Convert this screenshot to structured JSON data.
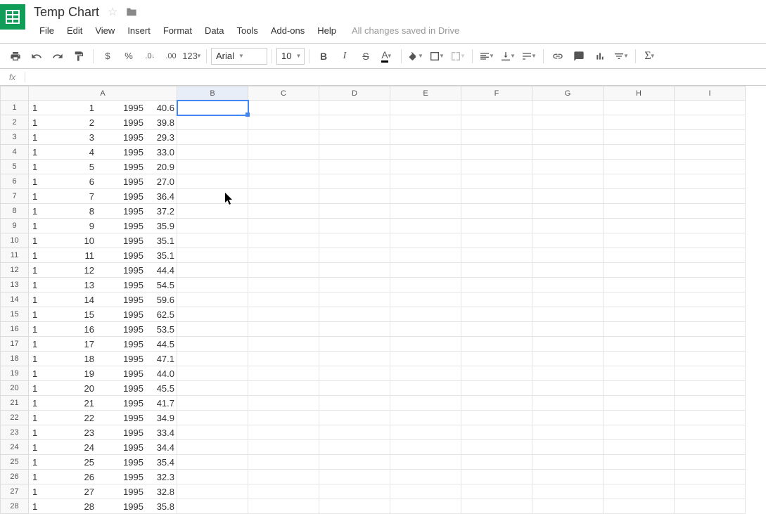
{
  "doc": {
    "title": "Temp Chart",
    "save_status": "All changes saved in Drive"
  },
  "menu": {
    "file": "File",
    "edit": "Edit",
    "view": "View",
    "insert": "Insert",
    "format": "Format",
    "data": "Data",
    "tools": "Tools",
    "addons": "Add-ons",
    "help": "Help"
  },
  "toolbar": {
    "currency": "$",
    "percent": "%",
    "dec_dec": ".0",
    "inc_dec": ".00",
    "num_format": "123",
    "font": "Arial",
    "font_size": "10",
    "bold": "B",
    "italic": "I",
    "strike": "S",
    "text_color": "A"
  },
  "formula_bar": {
    "fx": "fx",
    "value": ""
  },
  "columns": [
    "A",
    "B",
    "C",
    "D",
    "E",
    "F",
    "G",
    "H",
    "I"
  ],
  "rows": [
    {
      "n": 1,
      "c1": "1",
      "c2": "1",
      "c3": "1995",
      "c4": "40.6"
    },
    {
      "n": 2,
      "c1": "1",
      "c2": "2",
      "c3": "1995",
      "c4": "39.8"
    },
    {
      "n": 3,
      "c1": "1",
      "c2": "3",
      "c3": "1995",
      "c4": "29.3"
    },
    {
      "n": 4,
      "c1": "1",
      "c2": "4",
      "c3": "1995",
      "c4": "33.0"
    },
    {
      "n": 5,
      "c1": "1",
      "c2": "5",
      "c3": "1995",
      "c4": "20.9"
    },
    {
      "n": 6,
      "c1": "1",
      "c2": "6",
      "c3": "1995",
      "c4": "27.0"
    },
    {
      "n": 7,
      "c1": "1",
      "c2": "7",
      "c3": "1995",
      "c4": "36.4"
    },
    {
      "n": 8,
      "c1": "1",
      "c2": "8",
      "c3": "1995",
      "c4": "37.2"
    },
    {
      "n": 9,
      "c1": "1",
      "c2": "9",
      "c3": "1995",
      "c4": "35.9"
    },
    {
      "n": 10,
      "c1": "1",
      "c2": "10",
      "c3": "1995",
      "c4": "35.1"
    },
    {
      "n": 11,
      "c1": "1",
      "c2": "11",
      "c3": "1995",
      "c4": "35.1"
    },
    {
      "n": 12,
      "c1": "1",
      "c2": "12",
      "c3": "1995",
      "c4": "44.4"
    },
    {
      "n": 13,
      "c1": "1",
      "c2": "13",
      "c3": "1995",
      "c4": "54.5"
    },
    {
      "n": 14,
      "c1": "1",
      "c2": "14",
      "c3": "1995",
      "c4": "59.6"
    },
    {
      "n": 15,
      "c1": "1",
      "c2": "15",
      "c3": "1995",
      "c4": "62.5"
    },
    {
      "n": 16,
      "c1": "1",
      "c2": "16",
      "c3": "1995",
      "c4": "53.5"
    },
    {
      "n": 17,
      "c1": "1",
      "c2": "17",
      "c3": "1995",
      "c4": "44.5"
    },
    {
      "n": 18,
      "c1": "1",
      "c2": "18",
      "c3": "1995",
      "c4": "47.1"
    },
    {
      "n": 19,
      "c1": "1",
      "c2": "19",
      "c3": "1995",
      "c4": "44.0"
    },
    {
      "n": 20,
      "c1": "1",
      "c2": "20",
      "c3": "1995",
      "c4": "45.5"
    },
    {
      "n": 21,
      "c1": "1",
      "c2": "21",
      "c3": "1995",
      "c4": "41.7"
    },
    {
      "n": 22,
      "c1": "1",
      "c2": "22",
      "c3": "1995",
      "c4": "34.9"
    },
    {
      "n": 23,
      "c1": "1",
      "c2": "23",
      "c3": "1995",
      "c4": "33.4"
    },
    {
      "n": 24,
      "c1": "1",
      "c2": "24",
      "c3": "1995",
      "c4": "34.4"
    },
    {
      "n": 25,
      "c1": "1",
      "c2": "25",
      "c3": "1995",
      "c4": "35.4"
    },
    {
      "n": 26,
      "c1": "1",
      "c2": "26",
      "c3": "1995",
      "c4": "32.3"
    },
    {
      "n": 27,
      "c1": "1",
      "c2": "27",
      "c3": "1995",
      "c4": "32.8"
    },
    {
      "n": 28,
      "c1": "1",
      "c2": "28",
      "c3": "1995",
      "c4": "35.8"
    }
  ]
}
